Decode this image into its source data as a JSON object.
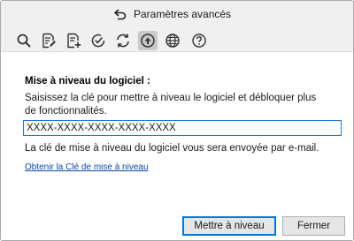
{
  "window": {
    "title": "Paramètres avancés"
  },
  "toolbar": {
    "icons": [
      "search-icon",
      "document-edit-icon",
      "document-add-icon",
      "check-circle-icon",
      "refresh-icon",
      "upgrade-icon",
      "globe-icon",
      "help-icon"
    ],
    "active": "upgrade-icon"
  },
  "upgrade": {
    "heading": "Mise à niveau du logiciel :",
    "description": "Saisissez la clé pour mettre à niveau le logiciel et débloquer plus de fonctionnalités.",
    "key_value": "XXXX-XXXX-XXXX-XXXX-XXXX",
    "note": "La clé de mise à niveau du logiciel vous sera envoyée par e-mail.",
    "link": "Obtenir la Clé de mise à niveau"
  },
  "buttons": {
    "upgrade": "Mettre à niveau",
    "close": "Fermer"
  },
  "colors": {
    "accent": "#0078d7",
    "link": "#0645ad",
    "toolbar_bg": "#f0f0f0"
  }
}
